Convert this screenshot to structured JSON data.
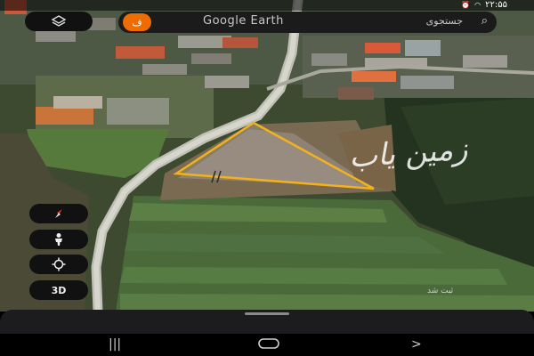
{
  "status_bar": {
    "clock": "۲۲:۵۵",
    "icons": [
      "alarm-icon",
      "wifi-icon"
    ]
  },
  "top_bar": {
    "layers_icon": "layers-icon",
    "avatar_letter": "ف",
    "app_title": "Google Earth",
    "search_label": "جستجوی",
    "search_icon": "search-icon"
  },
  "map": {
    "type": "satellite",
    "parcel_outline_color": "#f2b21b",
    "watermark_text": "زمین یاب",
    "attribution": "ثبت شد"
  },
  "side_controls": {
    "compass_icon": "compass-icon",
    "street_view_icon": "pegman-icon",
    "location_icon": "my-location-icon",
    "view_3d_label": "3D"
  },
  "nav_bar": {
    "recents_icon": "recents-icon",
    "home_icon": "home-icon",
    "back_icon": "back-icon"
  }
}
